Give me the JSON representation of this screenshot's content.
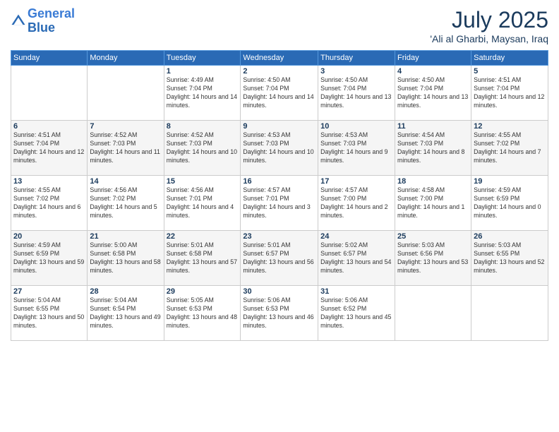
{
  "header": {
    "logo_line1": "General",
    "logo_line2": "Blue",
    "month_year": "July 2025",
    "location": "'Ali al Gharbi, Maysan, Iraq"
  },
  "weekdays": [
    "Sunday",
    "Monday",
    "Tuesday",
    "Wednesday",
    "Thursday",
    "Friday",
    "Saturday"
  ],
  "weeks": [
    [
      {
        "day": "",
        "info": ""
      },
      {
        "day": "",
        "info": ""
      },
      {
        "day": "1",
        "info": "Sunrise: 4:49 AM\nSunset: 7:04 PM\nDaylight: 14 hours and 14 minutes."
      },
      {
        "day": "2",
        "info": "Sunrise: 4:50 AM\nSunset: 7:04 PM\nDaylight: 14 hours and 14 minutes."
      },
      {
        "day": "3",
        "info": "Sunrise: 4:50 AM\nSunset: 7:04 PM\nDaylight: 14 hours and 13 minutes."
      },
      {
        "day": "4",
        "info": "Sunrise: 4:50 AM\nSunset: 7:04 PM\nDaylight: 14 hours and 13 minutes."
      },
      {
        "day": "5",
        "info": "Sunrise: 4:51 AM\nSunset: 7:04 PM\nDaylight: 14 hours and 12 minutes."
      }
    ],
    [
      {
        "day": "6",
        "info": "Sunrise: 4:51 AM\nSunset: 7:04 PM\nDaylight: 14 hours and 12 minutes."
      },
      {
        "day": "7",
        "info": "Sunrise: 4:52 AM\nSunset: 7:03 PM\nDaylight: 14 hours and 11 minutes."
      },
      {
        "day": "8",
        "info": "Sunrise: 4:52 AM\nSunset: 7:03 PM\nDaylight: 14 hours and 10 minutes."
      },
      {
        "day": "9",
        "info": "Sunrise: 4:53 AM\nSunset: 7:03 PM\nDaylight: 14 hours and 10 minutes."
      },
      {
        "day": "10",
        "info": "Sunrise: 4:53 AM\nSunset: 7:03 PM\nDaylight: 14 hours and 9 minutes."
      },
      {
        "day": "11",
        "info": "Sunrise: 4:54 AM\nSunset: 7:03 PM\nDaylight: 14 hours and 8 minutes."
      },
      {
        "day": "12",
        "info": "Sunrise: 4:55 AM\nSunset: 7:02 PM\nDaylight: 14 hours and 7 minutes."
      }
    ],
    [
      {
        "day": "13",
        "info": "Sunrise: 4:55 AM\nSunset: 7:02 PM\nDaylight: 14 hours and 6 minutes."
      },
      {
        "day": "14",
        "info": "Sunrise: 4:56 AM\nSunset: 7:02 PM\nDaylight: 14 hours and 5 minutes."
      },
      {
        "day": "15",
        "info": "Sunrise: 4:56 AM\nSunset: 7:01 PM\nDaylight: 14 hours and 4 minutes."
      },
      {
        "day": "16",
        "info": "Sunrise: 4:57 AM\nSunset: 7:01 PM\nDaylight: 14 hours and 3 minutes."
      },
      {
        "day": "17",
        "info": "Sunrise: 4:57 AM\nSunset: 7:00 PM\nDaylight: 14 hours and 2 minutes."
      },
      {
        "day": "18",
        "info": "Sunrise: 4:58 AM\nSunset: 7:00 PM\nDaylight: 14 hours and 1 minute."
      },
      {
        "day": "19",
        "info": "Sunrise: 4:59 AM\nSunset: 6:59 PM\nDaylight: 14 hours and 0 minutes."
      }
    ],
    [
      {
        "day": "20",
        "info": "Sunrise: 4:59 AM\nSunset: 6:59 PM\nDaylight: 13 hours and 59 minutes."
      },
      {
        "day": "21",
        "info": "Sunrise: 5:00 AM\nSunset: 6:58 PM\nDaylight: 13 hours and 58 minutes."
      },
      {
        "day": "22",
        "info": "Sunrise: 5:01 AM\nSunset: 6:58 PM\nDaylight: 13 hours and 57 minutes."
      },
      {
        "day": "23",
        "info": "Sunrise: 5:01 AM\nSunset: 6:57 PM\nDaylight: 13 hours and 56 minutes."
      },
      {
        "day": "24",
        "info": "Sunrise: 5:02 AM\nSunset: 6:57 PM\nDaylight: 13 hours and 54 minutes."
      },
      {
        "day": "25",
        "info": "Sunrise: 5:03 AM\nSunset: 6:56 PM\nDaylight: 13 hours and 53 minutes."
      },
      {
        "day": "26",
        "info": "Sunrise: 5:03 AM\nSunset: 6:55 PM\nDaylight: 13 hours and 52 minutes."
      }
    ],
    [
      {
        "day": "27",
        "info": "Sunrise: 5:04 AM\nSunset: 6:55 PM\nDaylight: 13 hours and 50 minutes."
      },
      {
        "day": "28",
        "info": "Sunrise: 5:04 AM\nSunset: 6:54 PM\nDaylight: 13 hours and 49 minutes."
      },
      {
        "day": "29",
        "info": "Sunrise: 5:05 AM\nSunset: 6:53 PM\nDaylight: 13 hours and 48 minutes."
      },
      {
        "day": "30",
        "info": "Sunrise: 5:06 AM\nSunset: 6:53 PM\nDaylight: 13 hours and 46 minutes."
      },
      {
        "day": "31",
        "info": "Sunrise: 5:06 AM\nSunset: 6:52 PM\nDaylight: 13 hours and 45 minutes."
      },
      {
        "day": "",
        "info": ""
      },
      {
        "day": "",
        "info": ""
      }
    ]
  ]
}
